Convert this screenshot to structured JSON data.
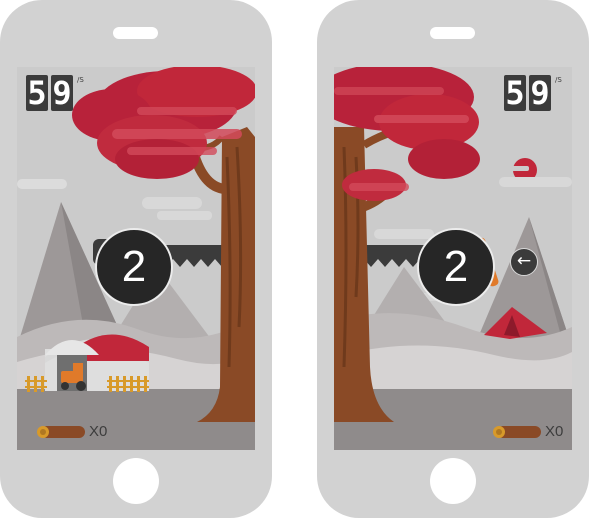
{
  "colors": {
    "phone_body": "#d2d2d2",
    "sky": "#cbcbcb",
    "tree_red": "#c1273a",
    "trunk": "#8a4a26",
    "saw": "#3b3b3b",
    "ground": "#8f8b8b"
  },
  "left_phone": {
    "timer": {
      "digits": [
        "5",
        "9"
      ],
      "unit": "/S"
    },
    "countdown": "2",
    "log_count": "X0"
  },
  "right_phone": {
    "timer": {
      "digits": [
        "5",
        "9"
      ],
      "unit": "/S"
    },
    "countdown": "2",
    "arrow_icon": "arrow-left-icon",
    "arrow_glyph": "←",
    "log_count": "X0"
  }
}
